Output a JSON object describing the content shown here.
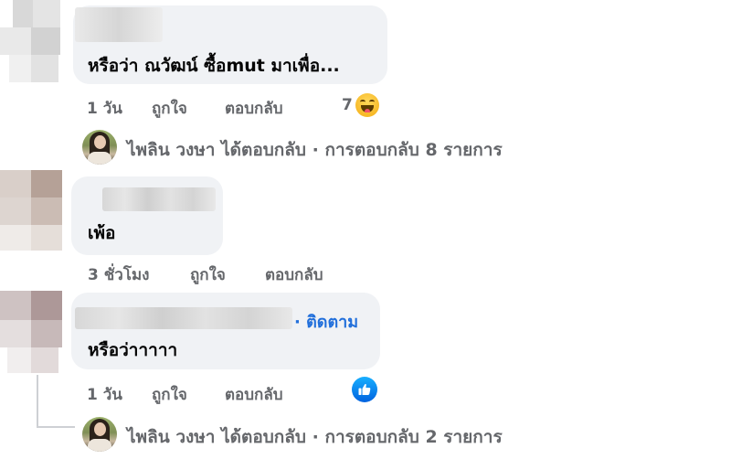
{
  "comments": [
    {
      "text": "หรือว่า ณวัฒน์ ซื้อmut มาเพื่อ...",
      "time": "1 วัน",
      "like": "ถูกใจ",
      "reply": "ตอบกลับ",
      "reaction_count": "7",
      "reaction_icon": "laugh-emoji"
    },
    {
      "text": "เพ้อ",
      "time": "3 ชั่วโมง",
      "like": "ถูกใจ",
      "reply": "ตอบกลับ"
    },
    {
      "text": "หรือว่าาาาา",
      "follow": "· ติดตาม",
      "time": "1 วัน",
      "like": "ถูกใจ",
      "reply": "ตอบกลับ",
      "reaction_icon": "like-icon"
    }
  ],
  "replies": [
    {
      "text": "ไพลิน วงษา ได้ตอบกลับ · การตอบกลับ 8 รายการ"
    },
    {
      "text": "ไพลิน วงษา ได้ตอบกลับ · การตอบกลับ 2 รายการ"
    }
  ],
  "colors": {
    "bubble": "#f0f2f5",
    "secondary_text": "#65676b",
    "link_blue": "#216fdb"
  }
}
